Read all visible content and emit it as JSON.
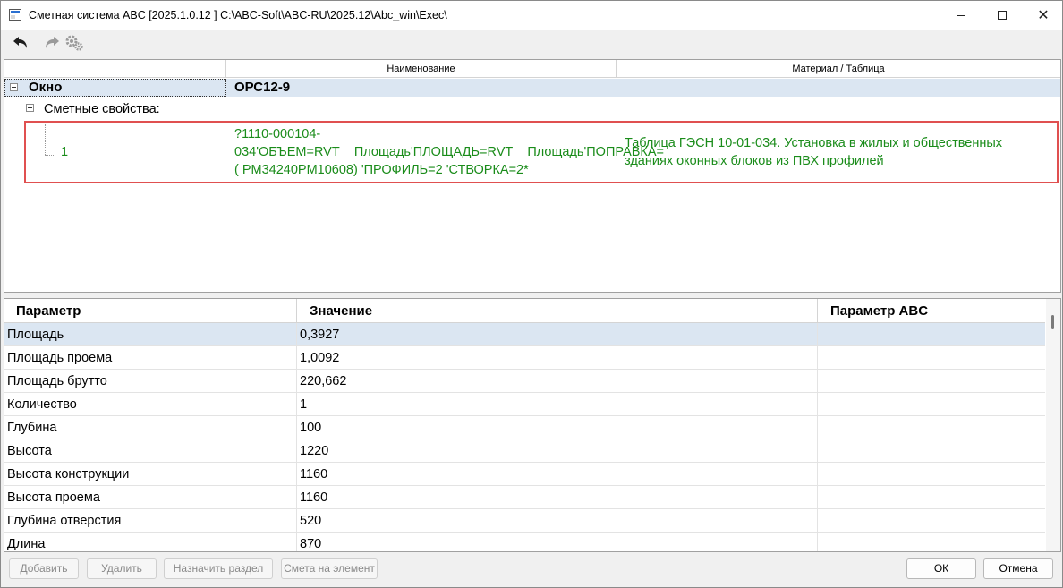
{
  "window": {
    "title": "Сметная система ABC [2025.1.0.12 ]   C:\\ABC-Soft\\ABC-RU\\2025.12\\Abc_win\\Exec\\",
    "minimize_label": "",
    "maximize_label": "",
    "close_label": "✕"
  },
  "toolbar": {
    "undo_icon": "undo-arrow-icon",
    "redo_icon": "redo-arrow-icon",
    "settings_icon": "gears-icon"
  },
  "tree": {
    "columns": [
      "",
      "Наименование",
      "Материал / Таблица"
    ],
    "root": {
      "name": "Окно",
      "value": "ОРС12-9"
    },
    "group": {
      "label": "Сметные свойства:"
    },
    "item": {
      "number": "1",
      "code": "?1110-000104-034'ОБЪЕМ=RVT__Площадь'ПЛОЩАДЬ=RVT__Площадь'ПОПРАВКА=  ( PM34240PM10608)   'ПРОФИЛЬ=2 'СТВОРКА=2*",
      "table": "Таблица ГЭСН 10-01-034. Установка в жилых и общественных зданиях оконных блоков из ПВХ профилей"
    }
  },
  "params": {
    "columns": [
      "Параметр",
      "Значение",
      "Параметр ABC"
    ],
    "rows": [
      {
        "name": "Площадь",
        "value": "0,3927",
        "abc": ""
      },
      {
        "name": "Площадь проема",
        "value": "1,0092",
        "abc": ""
      },
      {
        "name": "Площадь брутто",
        "value": "220,662",
        "abc": ""
      },
      {
        "name": "Количество",
        "value": "1",
        "abc": ""
      },
      {
        "name": "Глубина",
        "value": "100",
        "abc": ""
      },
      {
        "name": "Высота",
        "value": "1220",
        "abc": ""
      },
      {
        "name": "Высота конструкции",
        "value": "1160",
        "abc": ""
      },
      {
        "name": "Высота проема",
        "value": "1160",
        "abc": ""
      },
      {
        "name": "Глубина отверстия",
        "value": "520",
        "abc": ""
      },
      {
        "name": "Длина",
        "value": "870",
        "abc": ""
      }
    ]
  },
  "buttons": {
    "add": "Добавить",
    "delete": "Удалить",
    "assign_section": "Назначить раздел",
    "estimate_element": "Смета на элемент",
    "ok": "ОК",
    "cancel": "Отмена"
  },
  "colors": {
    "selection": "#dbe6f2",
    "green_text": "#1a8c1a",
    "highlight_border": "#e05050"
  }
}
